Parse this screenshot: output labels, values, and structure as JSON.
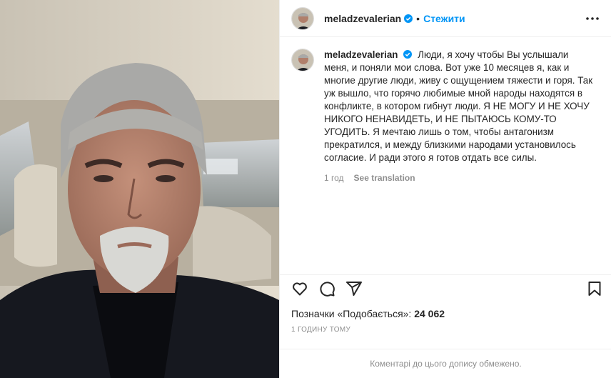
{
  "post": {
    "username": "meladzevalerian",
    "follow_label": "Стежити",
    "caption": "Люди, я хочу чтобы Вы услышали меня, и поняли мои слова. Вот уже 10 месяцев я, как и многие другие люди, живу с ощущением тяжести и горя. Так уж вышло, что горячо любимые мной народы находятся в конфликте, в котором гибнут люди. Я НЕ МОГУ И НЕ ХОЧУ НИКОГО НЕНАВИДЕТЬ, И НЕ ПЫТАЮСЬ КОМУ-ТО УГОДИТЬ. Я мечтаю лишь о том, чтобы антагонизм прекратился, и между близкими народами установилось согласие. И ради этого я готов отдать все силы.",
    "caption_age": "1 год",
    "translate_label": "See translation",
    "likes_label": "Позначки «Подобається»:",
    "likes_count": "24 062",
    "timestamp": "1 ГОДИНУ ТОМУ",
    "comments_disabled": "Коментарі до цього допису обмежено."
  },
  "icons": {
    "verified": "verified-badge-icon",
    "more": "more-options-icon",
    "like": "heart-icon",
    "comment": "comment-icon",
    "share": "share-icon",
    "save": "bookmark-icon"
  },
  "colors": {
    "accent": "#0095f6",
    "text": "#262626",
    "muted": "#8e8e8e",
    "border": "#efefef"
  }
}
